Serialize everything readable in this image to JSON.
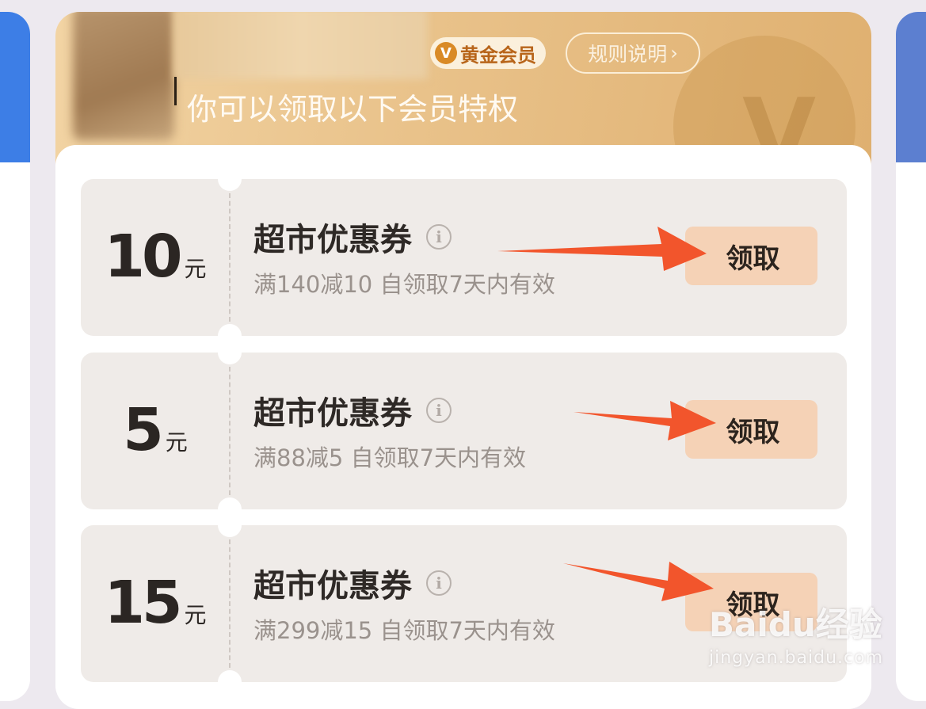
{
  "header": {
    "member_badge_icon": "V",
    "member_badge": "黄金会员",
    "rules_button": "规则说明",
    "rules_chevron": "›",
    "subtitle": "你可以领取以下会员特权",
    "deco_letter": "V"
  },
  "coupons": [
    {
      "amount": "10",
      "unit": "元",
      "title": "超市优惠券",
      "info": "i",
      "desc": "满140减10 自领取7天内有效",
      "button": "领取"
    },
    {
      "amount": "5",
      "unit": "元",
      "title": "超市优惠券",
      "info": "i",
      "desc": "满88减5 自领取7天内有效",
      "button": "领取"
    },
    {
      "amount": "15",
      "unit": "元",
      "title": "超市优惠券",
      "info": "i",
      "desc": "满299减15 自领取7天内有效",
      "button": "领取"
    }
  ],
  "watermark": {
    "logo": "Baidu经验",
    "url": "jingyan.baidu.com"
  },
  "colors": {
    "gold_header": "#e9c28a",
    "claim_button": "#f5d2b6",
    "arrow": "#f2552c",
    "coupon_bg": "#efebe8"
  }
}
